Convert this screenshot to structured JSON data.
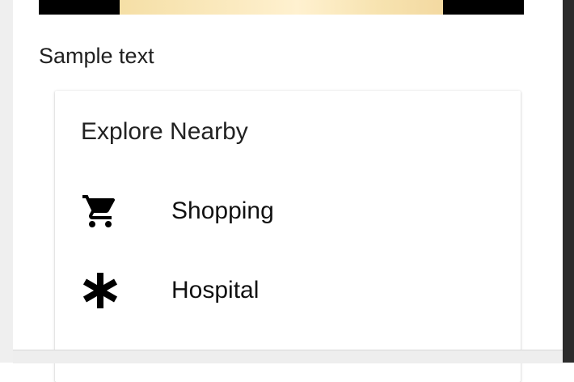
{
  "sample_text": "Sample text",
  "card": {
    "title": "Explore Nearby",
    "items": [
      {
        "label": "Shopping",
        "icon": "shopping-cart-icon"
      },
      {
        "label": "Hospital",
        "icon": "asterisk-icon"
      }
    ]
  },
  "colors": {
    "text": "#111111",
    "card_background": "#ffffff",
    "side_panel_dark": "#2c2c2c"
  }
}
